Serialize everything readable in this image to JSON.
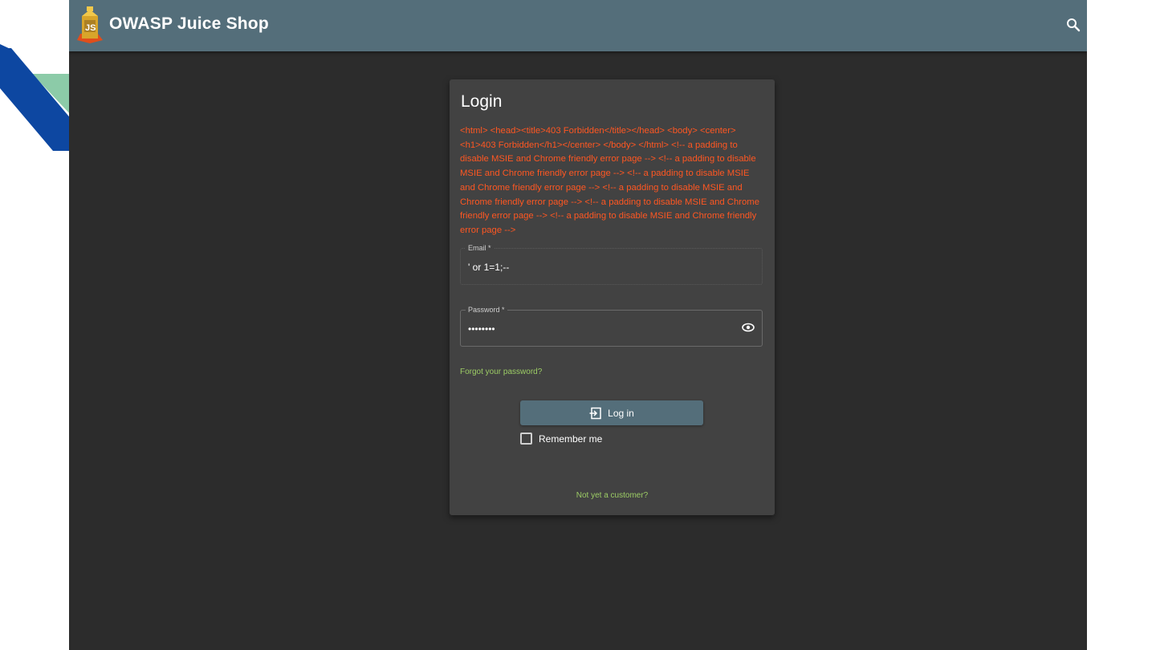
{
  "app": {
    "title": "OWASP Juice Shop",
    "logo_icon": "juice-carton-icon",
    "search_icon": "search-icon",
    "toolbar_color": "#546e7a"
  },
  "login": {
    "title": "Login",
    "error_message": "<html> <head><title>403 Forbidden</title></head> <body> <center><h1>403 Forbidden</h1></center> </body> </html> <!-- a padding to disable MSIE and Chrome friendly error page --> <!-- a padding to disable MSIE and Chrome friendly error page --> <!-- a padding to disable MSIE and Chrome friendly error page --> <!-- a padding to disable MSIE and Chrome friendly error page --> <!-- a padding to disable MSIE and Chrome friendly error page --> <!-- a padding to disable MSIE and Chrome friendly error page -->",
    "error_color": "#ff5722",
    "email_label": "Email *",
    "email_value": "' or 1=1;--",
    "password_label": "Password *",
    "password_value": "••••••••",
    "password_toggle_icon": "eye-icon",
    "forgot_password": "Forgot your password?",
    "login_button_label": "Log in",
    "login_icon": "login-icon",
    "remember_me_label": "Remember me",
    "register_link": "Not yet a customer?",
    "link_color": "#9ccc65"
  }
}
